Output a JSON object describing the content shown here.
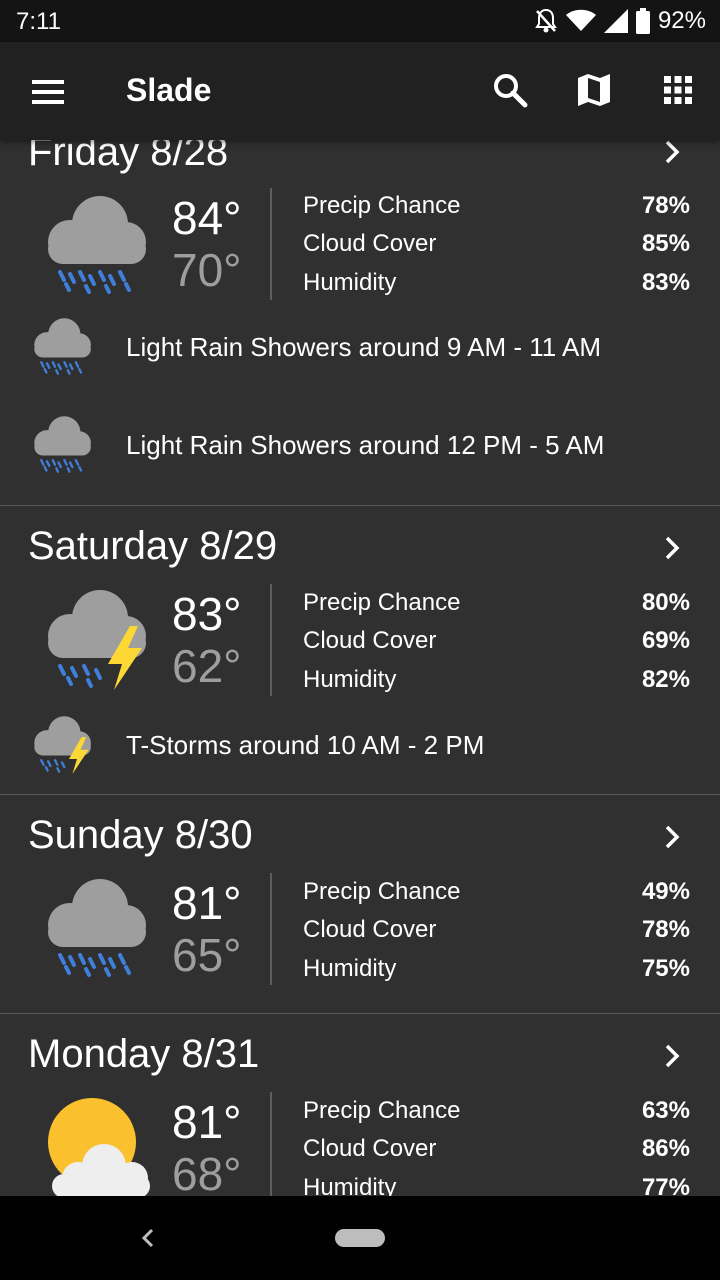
{
  "status_bar": {
    "time": "7:11",
    "battery": "92%",
    "icons": [
      "notifications-off-icon",
      "wifi-icon",
      "signal-icon",
      "battery-icon"
    ]
  },
  "app_bar": {
    "title": "Slade",
    "icons": [
      "menu-icon",
      "search-icon",
      "map-icon",
      "grid-icon"
    ]
  },
  "days": [
    {
      "title": "Friday 8/28",
      "icon": "rain-icon",
      "high": "84°",
      "low": "70°",
      "stats": [
        {
          "label": "Precip Chance",
          "value": "78%"
        },
        {
          "label": "Cloud Cover",
          "value": "85%"
        },
        {
          "label": "Humidity",
          "value": "83%"
        }
      ],
      "forecasts": [
        {
          "icon": "rain-icon",
          "text": "Light Rain Showers around 9 AM - 11 AM"
        },
        {
          "icon": "rain-icon",
          "text": "Light Rain Showers around 12 PM - 5 AM"
        }
      ]
    },
    {
      "title": "Saturday 8/29",
      "icon": "thunderstorm-icon",
      "high": "83°",
      "low": "62°",
      "stats": [
        {
          "label": "Precip Chance",
          "value": "80%"
        },
        {
          "label": "Cloud Cover",
          "value": "69%"
        },
        {
          "label": "Humidity",
          "value": "82%"
        }
      ],
      "forecasts": [
        {
          "icon": "thunderstorm-icon",
          "text": "T-Storms around 10 AM - 2 PM"
        }
      ]
    },
    {
      "title": "Sunday 8/30",
      "icon": "rain-icon",
      "high": "81°",
      "low": "65°",
      "stats": [
        {
          "label": "Precip Chance",
          "value": "49%"
        },
        {
          "label": "Cloud Cover",
          "value": "78%"
        },
        {
          "label": "Humidity",
          "value": "75%"
        }
      ],
      "forecasts": []
    },
    {
      "title": "Monday 8/31",
      "icon": "partly-cloudy-icon",
      "high": "81°",
      "low": "68°",
      "stats": [
        {
          "label": "Precip Chance",
          "value": "63%"
        },
        {
          "label": "Cloud Cover",
          "value": "86%"
        },
        {
          "label": "Humidity",
          "value": "77%"
        }
      ],
      "forecasts": []
    }
  ],
  "colors": {
    "background": "#303030",
    "app_bar": "#212121",
    "status_bar": "#141414",
    "cloud": "#9e9e9e",
    "rain": "#3f7fd9",
    "lightning": "#fdd835",
    "sun": "#fbc02d",
    "low_temp": "#9e9e9e"
  }
}
